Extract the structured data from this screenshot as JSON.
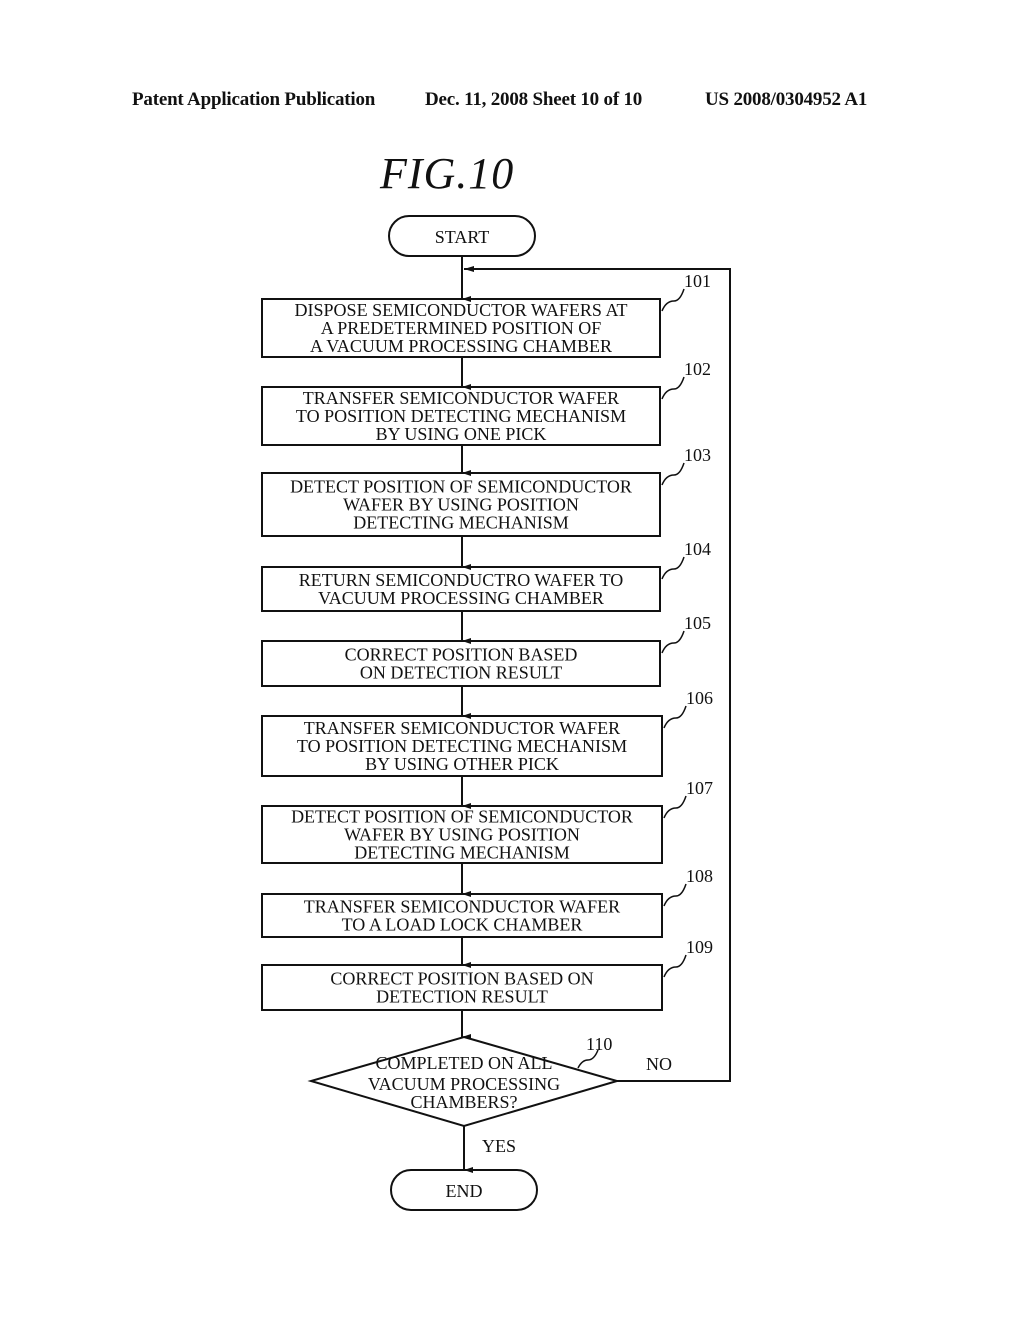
{
  "header": {
    "left": "Patent Application Publication",
    "middle": "Dec. 11, 2008  Sheet 10 of 10",
    "right": "US 2008/0304952 A1"
  },
  "figure": {
    "title": "FIG.10",
    "start": "START",
    "end": "END",
    "steps": [
      {
        "ref": "101",
        "lines": [
          "DISPOSE SEMICONDUCTOR WAFERS AT",
          "A PREDETERMINED POSITION OF",
          "A VACUUM PROCESSING CHAMBER"
        ]
      },
      {
        "ref": "102",
        "lines": [
          "TRANSFER SEMICONDUCTOR WAFER",
          "TO POSITION DETECTING MECHANISM",
          "BY USING ONE PICK"
        ]
      },
      {
        "ref": "103",
        "lines": [
          "DETECT POSITION OF SEMICONDUCTOR",
          "WAFER BY USING POSITION",
          "DETECTING MECHANISM"
        ]
      },
      {
        "ref": "104",
        "lines": [
          "RETURN SEMICONDUCTRO WAFER TO",
          "VACUUM PROCESSING CHAMBER"
        ]
      },
      {
        "ref": "105",
        "lines": [
          "CORRECT POSITION BASED",
          "ON DETECTION RESULT"
        ]
      },
      {
        "ref": "106",
        "lines": [
          "TRANSFER SEMICONDUCTOR WAFER",
          "TO POSITION DETECTING MECHANISM",
          "BY USING OTHER PICK"
        ]
      },
      {
        "ref": "107",
        "lines": [
          "DETECT POSITION OF SEMICONDUCTOR",
          "WAFER BY USING POSITION",
          "DETECTING MECHANISM"
        ]
      },
      {
        "ref": "108",
        "lines": [
          "TRANSFER SEMICONDUCTOR WAFER",
          "TO A LOAD LOCK CHAMBER"
        ]
      },
      {
        "ref": "109",
        "lines": [
          "CORRECT POSITION BASED ON",
          "DETECTION RESULT"
        ]
      }
    ],
    "decision": {
      "ref": "110",
      "lines": [
        "COMPLETED ON ALL",
        "VACUUM PROCESSING",
        "CHAMBERS?"
      ],
      "yes_label": "YES",
      "no_label": "NO"
    }
  }
}
